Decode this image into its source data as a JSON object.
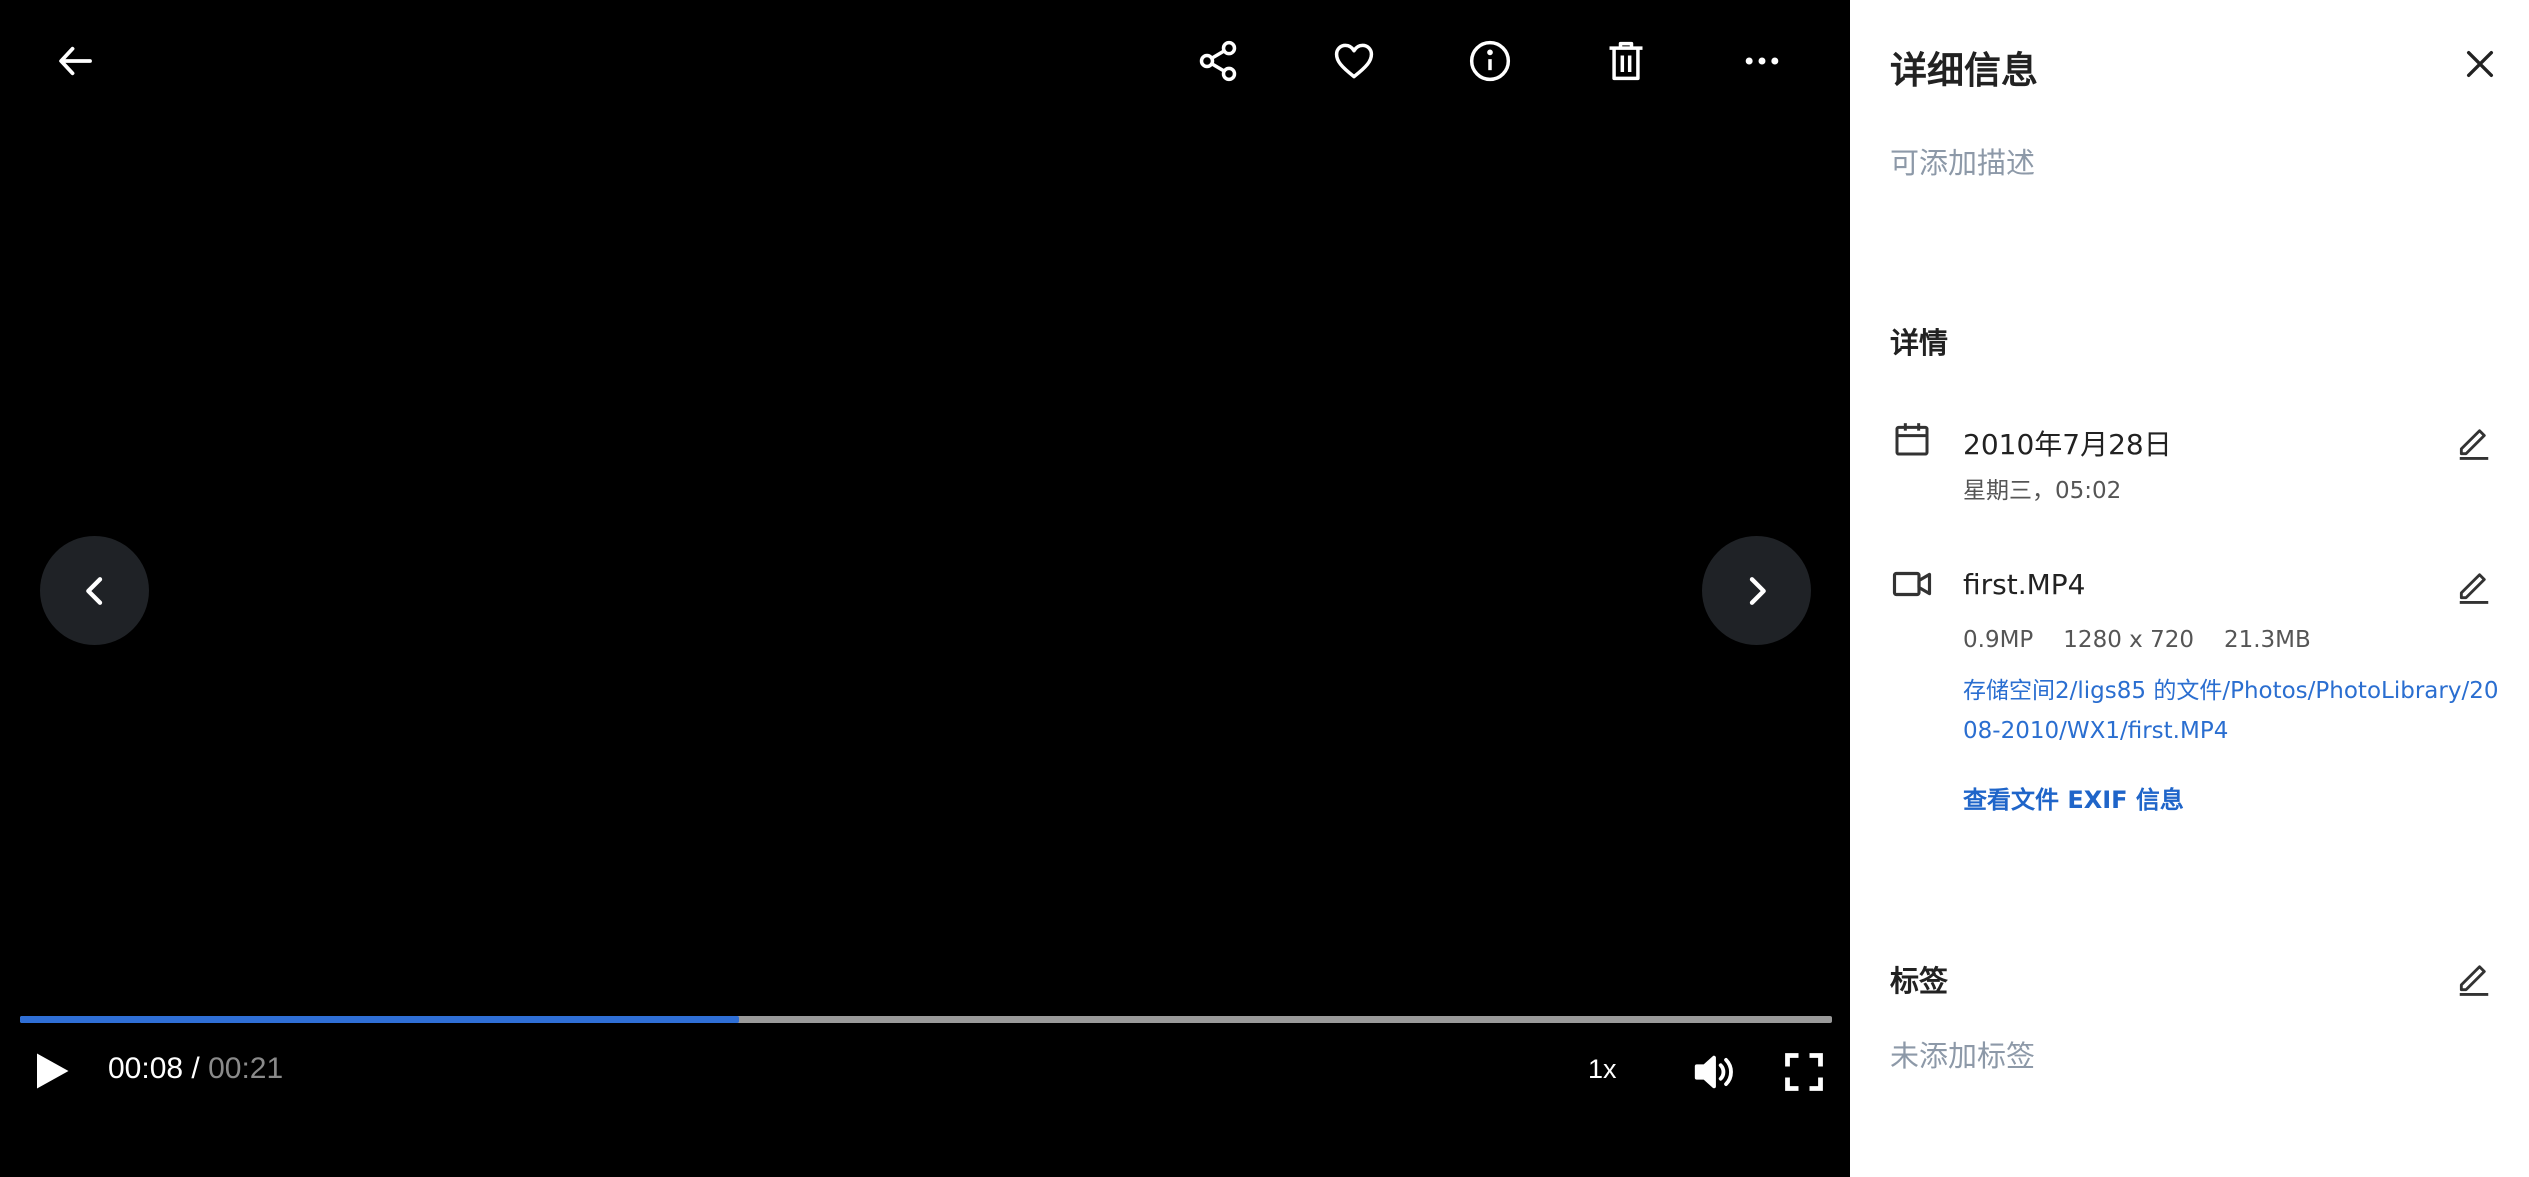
{
  "player": {
    "current_time": "00:08",
    "separator": " / ",
    "duration": "00:21",
    "progress": 0.397,
    "speed": "1x"
  },
  "toolbar": {
    "icons": [
      "back-arrow-icon",
      "share-icon",
      "heart-icon",
      "info-icon",
      "trash-icon",
      "more-horizontal-icon"
    ]
  },
  "panel": {
    "title": "详细信息",
    "description_placeholder": "可添加描述",
    "details_heading": "详情",
    "date": "2010年7月28日",
    "weekday_time": "星期三，05:02",
    "filename": "first.MP4",
    "megapixels": "0.9MP",
    "resolution": "1280 x 720",
    "filesize": "21.3MB",
    "path": "存储空间2/ligs85 的文件/Photos/PhotoLibrary/2008-2010/WX1/first.MP4",
    "exif_link": "查看文件 EXIF 信息",
    "tags_heading": "标签",
    "tags_placeholder": "未添加标签"
  },
  "colors": {
    "viewer_bg": "#000000",
    "progress_fill": "#2f6fd6",
    "progress_track": "#9a9a9a",
    "link": "#2a6ed0",
    "placeholder": "#8d99a8"
  }
}
